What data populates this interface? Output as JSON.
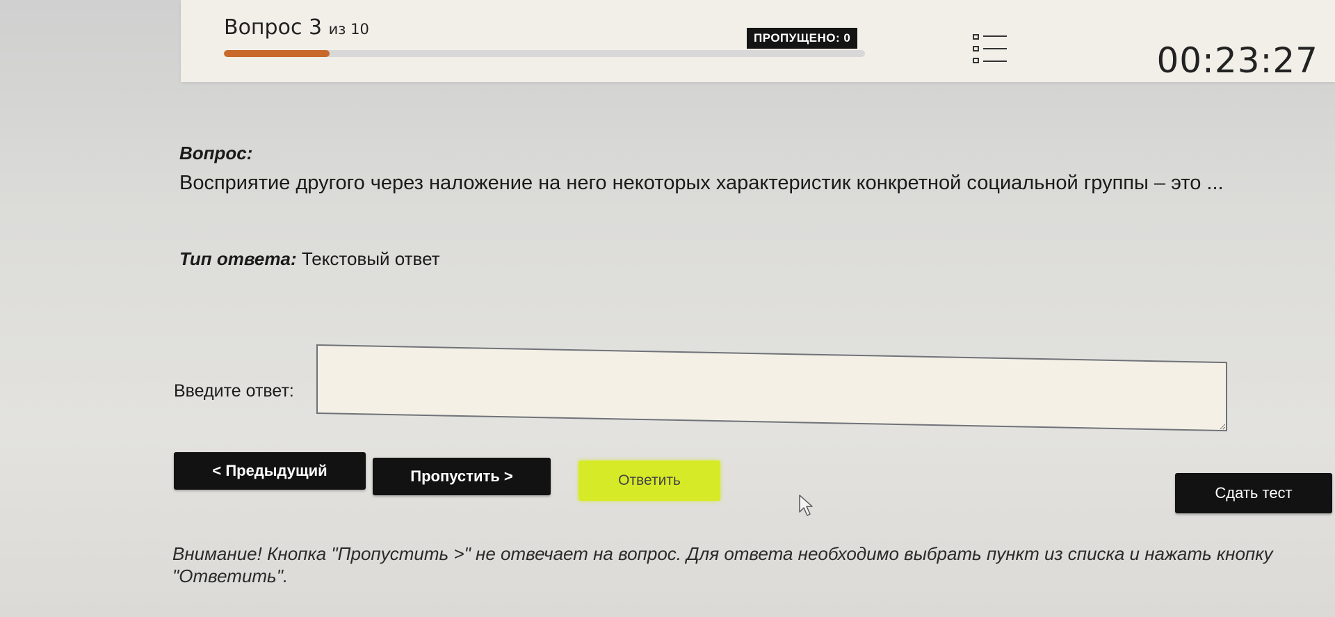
{
  "header": {
    "question_number": "Вопрос 3",
    "question_total": "из 10",
    "progress_fraction": 0.165,
    "skipped_label": "ПРОПУЩЕНО: 0",
    "timer": "00:23:27"
  },
  "question": {
    "label": "Вопрос:",
    "text": "Восприятие другого через наложение на него некоторых характеристик конкретной социальной группы – это ...",
    "answer_type_label": "Тип ответа:",
    "answer_type_value": "Текстовый ответ",
    "input_label": "Введите ответ:",
    "input_value": ""
  },
  "buttons": {
    "prev": "< Предыдущий",
    "skip": "Пропустить >",
    "answer": "Ответить",
    "submit": "Сдать тест"
  },
  "warning": "Внимание! Кнопка \"Пропустить >\" не отвечает на вопрос. Для ответа необходимо выбрать пункт из списка и нажать кнопку \"Ответить\".",
  "colors": {
    "progress_fill": "#c8692b",
    "answer_button": "#d6ea27",
    "dark_button": "#121212"
  },
  "icons": {
    "question_list": "list-icon",
    "mouse_cursor": "cursor-icon"
  }
}
